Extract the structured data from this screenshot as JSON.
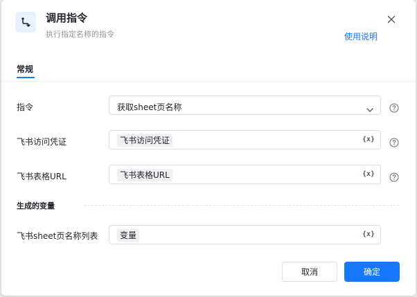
{
  "header": {
    "title": "调用指令",
    "subtitle": "执行指定名称的指令",
    "help_link": "使用说明",
    "icon": "command-route-icon"
  },
  "tabs": [
    {
      "label": "常规",
      "active": true
    }
  ],
  "fields": {
    "command": {
      "label": "指令",
      "value": "获取sheet页名称"
    },
    "credential": {
      "label": "飞书访问凭证",
      "value": "飞书访问凭证"
    },
    "sheet_url": {
      "label": "飞书表格URL",
      "value": "飞书表格URL"
    }
  },
  "output_section": {
    "title": "生成的变量",
    "fields": {
      "sheet_names": {
        "label": "飞书sheet页名称列表",
        "value": "变量"
      }
    }
  },
  "variable_icon_text": "{x}",
  "footer": {
    "cancel_label": "取消",
    "confirm_label": "确定"
  },
  "colors": {
    "accent": "#1677ff",
    "chip_bg": "#eef0f3",
    "border": "#dcdfe5"
  }
}
